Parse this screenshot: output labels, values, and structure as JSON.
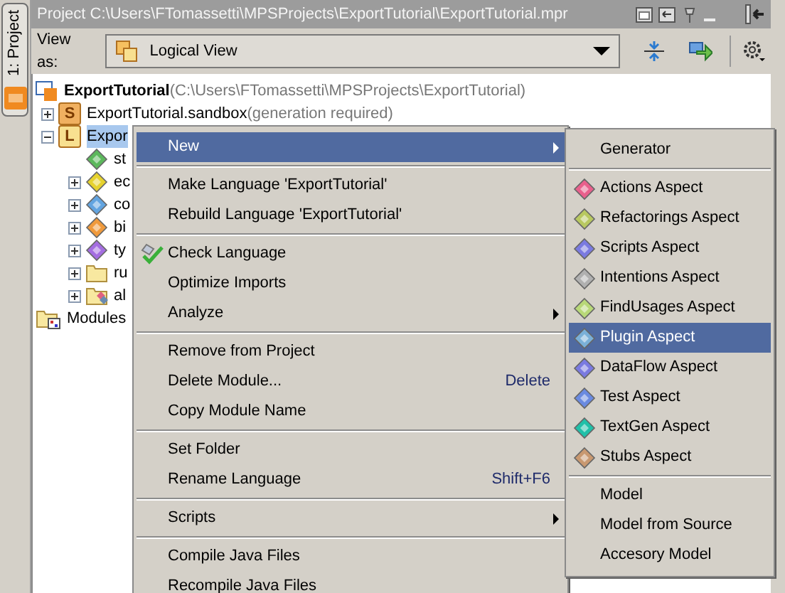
{
  "tool_strip": {
    "tab": {
      "label": "1: Project",
      "selected": true
    }
  },
  "title_bar": {
    "title": "Project C:\\Users\\FTomassetti\\MPSProjects\\ExportTutorial\\ExportTutorial.mpr"
  },
  "toolbar": {
    "label": "View as:",
    "view": "Logical View"
  },
  "tree": [
    {
      "kind": "project",
      "label": "ExportTutorial",
      "note": "(C:\\Users\\FTomassetti\\MPSProjects\\ExportTutorial)",
      "selected": false,
      "children": [
        {
          "kind": "solution",
          "badge": "S",
          "label": "ExportTutorial.sandbox",
          "note": "(generation required)",
          "selected": false,
          "expanded": false
        },
        {
          "kind": "language",
          "badge": "L",
          "label": "Expor",
          "selected": true,
          "expanded": true,
          "children": [
            {
              "kind": "model",
              "color": "#5cb85c",
              "label": "st",
              "selected": false
            },
            {
              "kind": "model",
              "color": "#e6d22e",
              "label": "ec",
              "selected": false,
              "expanded": false
            },
            {
              "kind": "model",
              "color": "#62a4e0",
              "label": "co",
              "selected": false,
              "expanded": false
            },
            {
              "kind": "model",
              "color": "#f09a3c",
              "label": "bi",
              "selected": false,
              "expanded": false
            },
            {
              "kind": "model",
              "color": "#a46ee0",
              "label": "ty",
              "selected": false,
              "expanded": false
            },
            {
              "kind": "folder",
              "label": "ru",
              "selected": false,
              "expanded": false
            },
            {
              "kind": "accessory",
              "label": "al",
              "selected": false,
              "expanded": false
            }
          ]
        }
      ]
    },
    {
      "kind": "modules",
      "label": "Modules",
      "selected": false
    }
  ],
  "context_menu": [
    {
      "kind": "item",
      "label": "New",
      "submenu": true,
      "selected": true
    },
    {
      "kind": "separator"
    },
    {
      "kind": "item",
      "label": "Make Language 'ExportTutorial'",
      "selected": false
    },
    {
      "kind": "item",
      "label": "Rebuild Language 'ExportTutorial'",
      "selected": false
    },
    {
      "kind": "separator"
    },
    {
      "kind": "item",
      "label": "Check Language",
      "has_icon": true,
      "selected": false
    },
    {
      "kind": "item",
      "label": "Optimize Imports",
      "selected": false
    },
    {
      "kind": "item",
      "label": "Analyze",
      "submenu": true,
      "selected": false
    },
    {
      "kind": "separator"
    },
    {
      "kind": "item",
      "label": "Remove from Project",
      "selected": false
    },
    {
      "kind": "item",
      "label": "Delete Module...",
      "shortcut": "Delete",
      "selected": false
    },
    {
      "kind": "item",
      "label": "Copy Module Name",
      "selected": false
    },
    {
      "kind": "separator"
    },
    {
      "kind": "item",
      "label": "Set Folder",
      "selected": false
    },
    {
      "kind": "item",
      "label": "Rename Language",
      "shortcut": "Shift+F6",
      "selected": false
    },
    {
      "kind": "separator"
    },
    {
      "kind": "item",
      "label": "Scripts",
      "submenu": true,
      "selected": false
    },
    {
      "kind": "separator"
    },
    {
      "kind": "item",
      "label": "Compile Java Files",
      "selected": false
    },
    {
      "kind": "item",
      "label": "Recompile Java Files",
      "selected": false
    }
  ],
  "new_submenu": [
    {
      "kind": "item",
      "label": "Generator",
      "selected": false
    },
    {
      "kind": "separator"
    },
    {
      "kind": "aspect",
      "color": "#e8608c",
      "label": "Actions Aspect",
      "selected": false
    },
    {
      "kind": "aspect",
      "color": "#b8c860",
      "label": "Refactorings Aspect",
      "selected": false
    },
    {
      "kind": "aspect",
      "color": "#7a7ae0",
      "label": "Scripts Aspect",
      "selected": false
    },
    {
      "kind": "aspect",
      "color": "#b0b0b0",
      "label": "Intentions Aspect",
      "selected": false
    },
    {
      "kind": "aspect",
      "color": "#b8d878",
      "label": "FindUsages Aspect",
      "selected": false
    },
    {
      "kind": "aspect",
      "color": "#7ab0d8",
      "label": "Plugin Aspect",
      "selected": true
    },
    {
      "kind": "aspect",
      "color": "#7a7ae0",
      "label": "DataFlow Aspect",
      "selected": false
    },
    {
      "kind": "aspect",
      "color": "#6a8ae0",
      "label": "Test Aspect",
      "selected": false
    },
    {
      "kind": "aspect",
      "color": "#20c0a8",
      "label": "TextGen Aspect",
      "selected": false
    },
    {
      "kind": "aspect",
      "color": "#c89870",
      "label": "Stubs Aspect",
      "selected": false
    },
    {
      "kind": "separator"
    },
    {
      "kind": "item",
      "label": "Model",
      "selected": false
    },
    {
      "kind": "item",
      "label": "Model from Source",
      "selected": false
    },
    {
      "kind": "item",
      "label": "Accesory Model",
      "selected": false
    }
  ]
}
